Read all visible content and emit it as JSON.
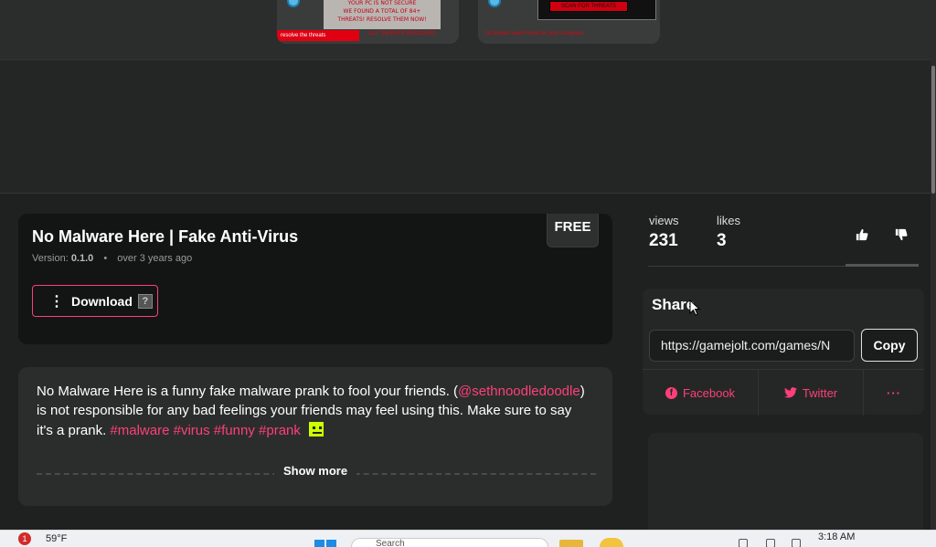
{
  "screenshots": {
    "shot1": {
      "lines": [
        "YOUR PC IS NOT SECURE",
        "WE FOUND A TOTAL OF 84+",
        "THREATS! RESOLVE THEM NOW!"
      ],
      "red_bar_text": "resolve the threats",
      "red_text": "ALL THREATS RESOLVED"
    },
    "shot2": {
      "scan_button": "SCAN FOR THREATS",
      "red_text": "No threats were found on your computer"
    }
  },
  "game": {
    "title": "No Malware Here | Fake Anti-Virus",
    "version_label": "Version:",
    "version": "0.1.0",
    "age": "over 3 years ago",
    "price_badge": "FREE",
    "download_label": "Download"
  },
  "description": {
    "part1": "No Malware Here is a funny fake malware prank to fool your friends. (",
    "mention": "@sethnoodledoodle",
    "part2": ") is not responsible for any bad feelings your friends may feel using this. Make sure to say it's a prank.",
    "tags": [
      "#malware",
      "#virus",
      "#funny",
      "#prank"
    ],
    "show_more": "Show more"
  },
  "stats": {
    "views_label": "views",
    "views": "231",
    "likes_label": "likes",
    "likes": "3"
  },
  "share": {
    "heading": "Share",
    "url": "https://gamejolt.com/games/N",
    "copy_label": "Copy",
    "facebook": "Facebook",
    "twitter": "Twitter",
    "more": "···"
  },
  "taskbar": {
    "notification_count": "1",
    "weather": "59°F",
    "search_placeholder": "Search",
    "time": "3:18 AM"
  },
  "colors": {
    "accent": "#ff3f7a",
    "background": "#1f2120",
    "card": "#2b2d2c"
  }
}
